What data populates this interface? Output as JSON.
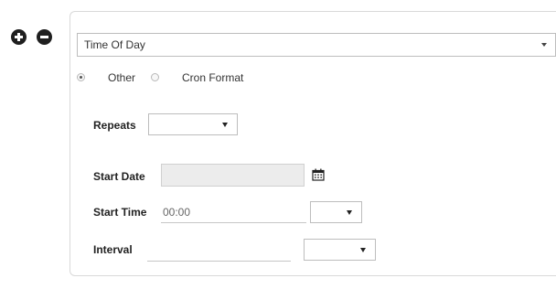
{
  "controls": {
    "add_icon": "plus-circle-icon",
    "remove_icon": "minus-circle-icon"
  },
  "schedule": {
    "type_select": {
      "value": "Time Of Day"
    },
    "mode": {
      "options": [
        "Other",
        "Cron Format"
      ],
      "selected": "Other"
    },
    "repeats": {
      "label": "Repeats",
      "value": ""
    },
    "start_date": {
      "label": "Start Date",
      "value": "",
      "icon": "calendar-icon"
    },
    "start_time": {
      "label": "Start Time",
      "value": "00:00",
      "unit_value": ""
    },
    "interval": {
      "label": "Interval",
      "value": "",
      "unit_value": ""
    }
  }
}
